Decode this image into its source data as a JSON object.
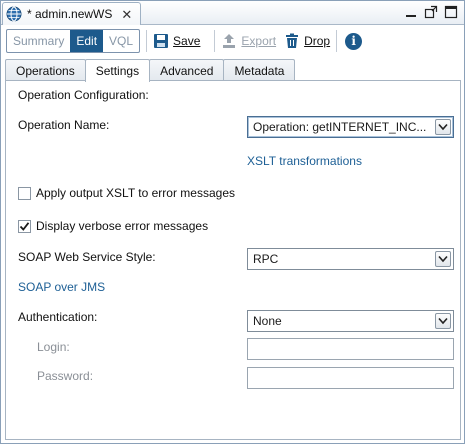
{
  "window": {
    "tab_title": "* admin.newWS",
    "close_glyph": "✕",
    "icons": [
      "globe-icon",
      "minimize-icon",
      "restore-icon",
      "maximize-icon"
    ]
  },
  "toolbar": {
    "modes": [
      "Summary",
      "Edit",
      "VQL"
    ],
    "active_mode": "Edit",
    "save_label": "Save",
    "export_label": "Export",
    "drop_label": "Drop",
    "info_glyph": "i"
  },
  "tabs": [
    "Operations",
    "Settings",
    "Advanced",
    "Metadata"
  ],
  "active_tab": "Settings",
  "settings": {
    "section_title": "Operation Configuration:",
    "operation_name_label": "Operation Name:",
    "operation_name_value": "Operation: getINTERNET_INC...",
    "xslt_link": "XSLT transformations",
    "apply_xslt_label": "Apply output XSLT to error messages",
    "apply_xslt_checked": false,
    "verbose_label": "Display verbose error messages",
    "verbose_checked": true,
    "soap_style_label": "SOAP Web Service Style:",
    "soap_style_value": "RPC",
    "soap_jms_link": "SOAP over JMS",
    "auth_label": "Authentication:",
    "auth_value": "None",
    "login_label": "Login:",
    "login_value": "",
    "password_label": "Password:",
    "password_value": ""
  },
  "colors": {
    "accent": "#1d5a8c",
    "link": "#1d5f95",
    "border": "#a7b4c2"
  }
}
